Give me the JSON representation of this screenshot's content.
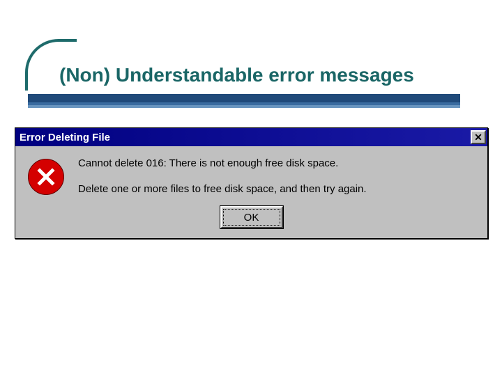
{
  "slide": {
    "title": "(Non) Understandable error messages"
  },
  "dialog": {
    "title": "Error Deleting File",
    "close_glyph": "✕",
    "message_line1": "Cannot delete 016: There is not enough free disk space.",
    "message_line2": "Delete one or more files to free disk space, and then try again.",
    "ok_label": "OK"
  }
}
